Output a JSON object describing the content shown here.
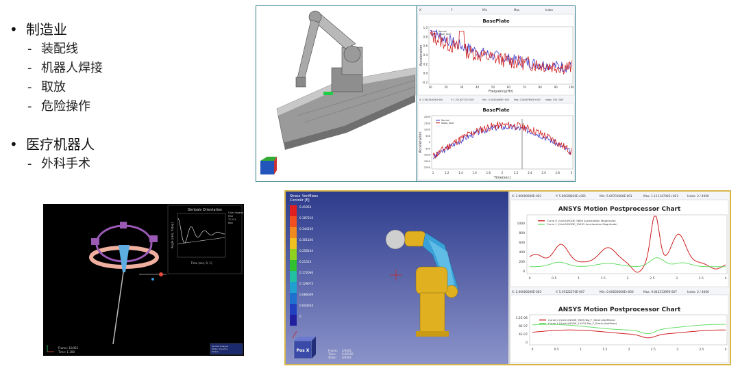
{
  "bullets": {
    "manufacturing": "制造业",
    "assembly": "装配线",
    "welding": "机器人焊接",
    "pickplace": "取放",
    "hazardous": "危险操作",
    "medical": "医疗机器人",
    "surgery": "外科手术"
  },
  "robot_panel": {
    "header": [
      "X",
      "Y",
      "Min",
      "Max",
      "Index"
    ],
    "chart_top": {
      "title": "BasePlate",
      "legend": [
        "Normal",
        "Robot_Fault"
      ],
      "ylabel": "Acceleration",
      "xlabel": "Frequency(Hz)",
      "yticks": [
        "1.0",
        "0.8",
        "0.6",
        "0.4",
        "0.2",
        "0.0",
        "-0.2"
      ],
      "xticks": [
        "10",
        "20",
        "30",
        "40",
        "50",
        "60",
        "70",
        "80",
        "90",
        "100"
      ]
    },
    "mid_header": [
      "X: 3.35435000E+000",
      "Y: 1.37192771E+003",
      "Min: -3.50434069E+003",
      "Max: 3.00497892E+003",
      "Index: 335 / 509"
    ],
    "chart_bottom": {
      "title": "BasePlate",
      "legend": [
        "Normal",
        "Robot_Fault"
      ],
      "ylabel": "Acceleration",
      "xlabel": "Time(sec)",
      "yticks": [
        "2000",
        "1500",
        "1000",
        "500",
        "0",
        "-500",
        "-1000",
        "-1500",
        "-2000"
      ],
      "xticks": [
        "1",
        "1.2",
        "1.4",
        "1.6",
        "1.8",
        "2",
        "2.2",
        "2.4",
        "2.6",
        "2.8",
        "3"
      ]
    }
  },
  "gimbal_panel": {
    "chart_title": "Gimbals Orientation",
    "ylabel": "Angle (rad), Y(deg)",
    "xlabel": "Time (sec, 0, 1)",
    "legend": [
      "Color legend",
      "RG2",
      "TO 0.5",
      "Red"
    ],
    "frame_label": "Frame: 12/451",
    "time_label": "Time: 1.308",
    "info": [
      "Gimbal Analysis",
      "Mode: Dynamic",
      "Model: ..."
    ]
  },
  "ansys_panel": {
    "contour_title": "Stress_VonMises",
    "contour_sub": "Contour [E]",
    "legend_values": [
      "0.41054",
      "0.387216",
      "0.344156",
      "0.301160",
      "0.258144",
      "0.21513",
      "0.172096",
      "0.129073",
      "0.086049",
      "0.043024",
      "0"
    ],
    "pos_label": "Pos X",
    "frame_info": [
      "Frame:",
      "Time:",
      "State:"
    ],
    "frame_values": [
      "2/4001",
      "0.00250",
      "0/4001"
    ],
    "header1": [
      "X: 2.00000000E-003",
      "Y: 5.66028826E+001",
      "Min: 5.60703066E-001",
      "Max: 1.11114749E+003",
      "Index: 2 / 4000"
    ],
    "chart1": {
      "title": "ANSYS Motion Postprocessor Chart",
      "legend": [
        "Curve 0 (/Link1/NODE_9609 Acceleration Magnitude)",
        "Curve 1 (/Link1/NODE_15432 Acceleration Magnitude)"
      ],
      "yticks": [
        "1000",
        "800",
        "600",
        "400",
        "200",
        "0"
      ],
      "xticks": [
        "0",
        "0.5",
        "1",
        "1.5",
        "2",
        "2.5",
        "3",
        "3.5",
        "4"
      ]
    },
    "header2": [
      "X: 2.00000000E-003",
      "Y: 5.39122270E-007",
      "Min: 0.00000000E+000",
      "Max: 9.04231399E-007",
      "Index: 2 / 4000"
    ],
    "chart2": {
      "title": "ANSYS Motion Postprocessor Chart",
      "legend": [
        "Curve 0 (/Link1/NODE_9609-Top_F_Strain-VonMises)",
        "Curve 1 (/Link1/NODE_15432-Top_F_Strain-VonMises)"
      ],
      "yticks": [
        "1.2E-06",
        "8E-07",
        "4E-07",
        "0"
      ],
      "xticks": [
        "0",
        "0.5",
        "1",
        "1.5",
        "2",
        "2.5",
        "3",
        "3.5",
        "4"
      ]
    }
  },
  "colors": {
    "accent_teal": "#2b7a86",
    "ansys_border": "#d8b64a",
    "red_series": "#d01c1c",
    "blue_series": "#3c3ccc",
    "green_series": "#66dd66"
  }
}
